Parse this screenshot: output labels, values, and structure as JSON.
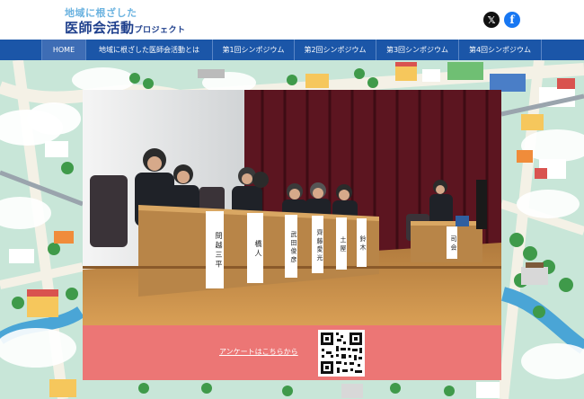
{
  "logo": {
    "line1": "地域に根ざした",
    "line2_main": "医師会活動",
    "line2_sub": "プロジェクト"
  },
  "social": {
    "x_glyph": "𝕏",
    "facebook_glyph": "f"
  },
  "nav": {
    "items": [
      {
        "label": "HOME"
      },
      {
        "label": "地域に根ざした医師会活動とは"
      },
      {
        "label": "第1回シンポジウム"
      },
      {
        "label": "第2回シンポジウム"
      },
      {
        "label": "第3回シンポジウム"
      },
      {
        "label": "第4回シンポジウム"
      }
    ]
  },
  "hero": {
    "nameplates": [
      "問 越 三 平",
      "橋 人",
      "武 田 俊 彦",
      "齊 藤 愛 光",
      "土 屋",
      "鈴 木"
    ],
    "podium_sign": "司 会"
  },
  "survey": {
    "link_text": "アンケートはこちらから"
  },
  "colors": {
    "nav_bg": "#1b56a8",
    "nav_active": "#3e6db5",
    "cta_bg": "#ec7675",
    "logo_dark": "#1e3f8c",
    "logo_light": "#6bb3e0"
  }
}
